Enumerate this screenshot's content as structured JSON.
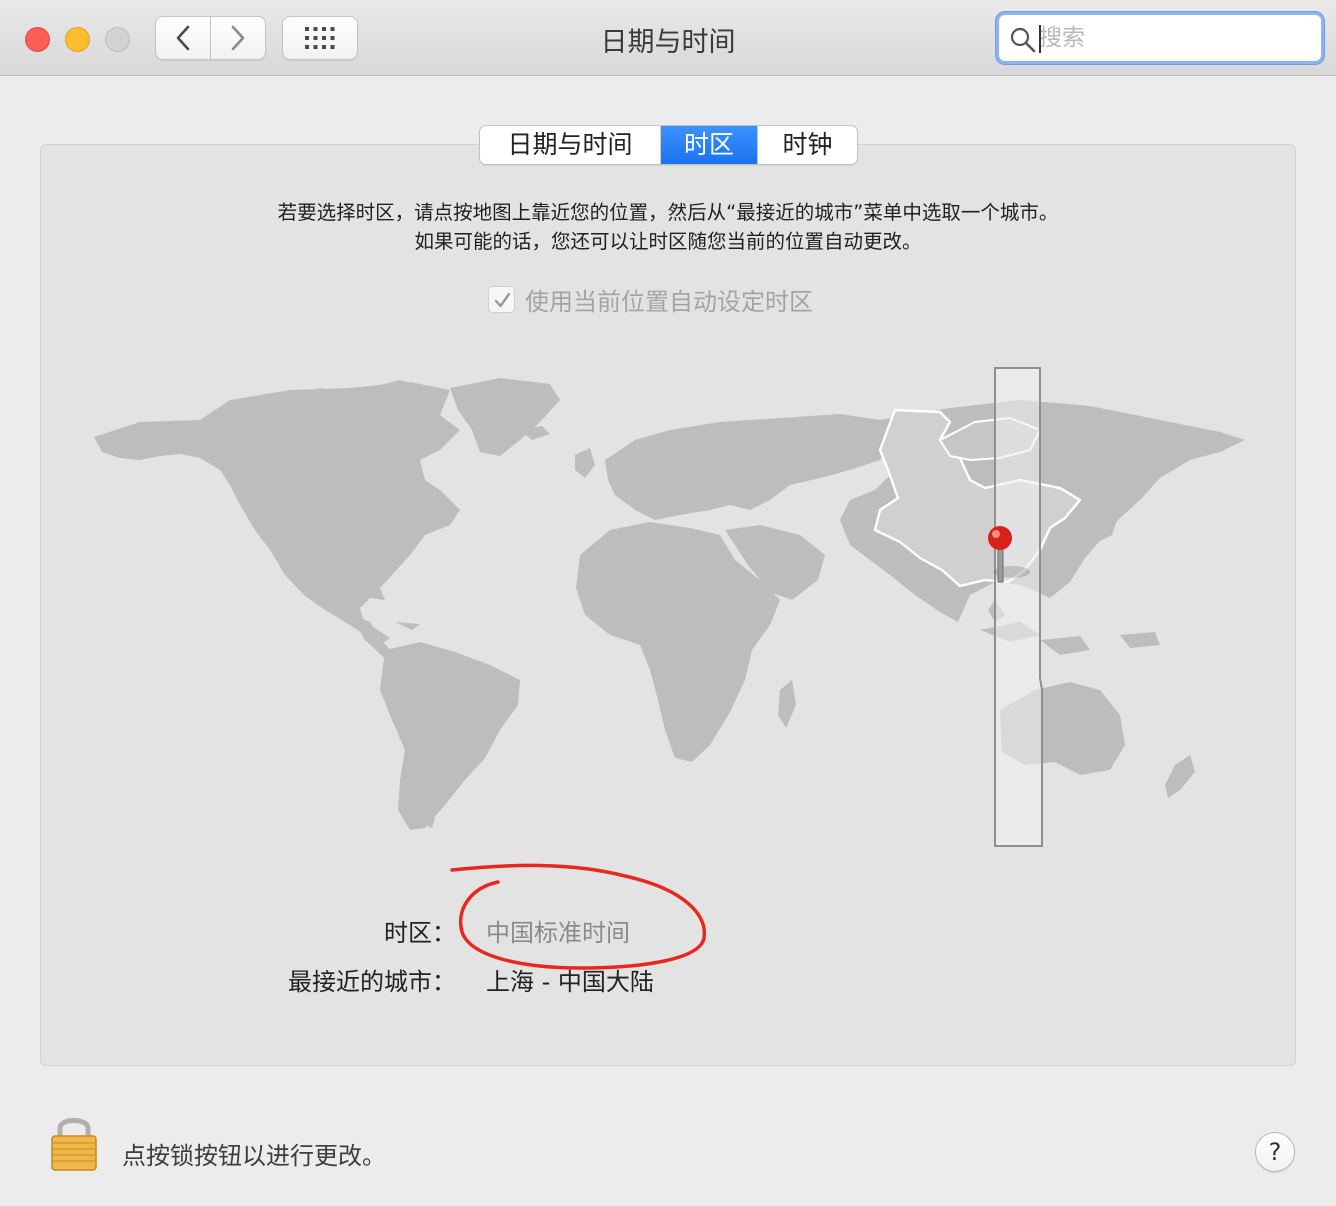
{
  "window": {
    "title": "日期与时间"
  },
  "toolbar": {
    "back_icon": "chevron-left-icon",
    "forward_icon": "chevron-right-icon",
    "grid_icon": "grid-icon"
  },
  "search": {
    "placeholder": "搜索",
    "value": ""
  },
  "tabs": [
    {
      "label": "日期与时间",
      "selected": false
    },
    {
      "label": "时区",
      "selected": true
    },
    {
      "label": "时钟",
      "selected": false
    }
  ],
  "instructions": {
    "line1": "若要选择时区，请点按地图上靠近您的位置，然后从“最接近的城市”菜单中选取一个城市。",
    "line2": "如果可能的话，您还可以让时区随您当前的位置自动更改。"
  },
  "auto_timezone": {
    "label": "使用当前位置自动设定时区",
    "checked": true,
    "enabled": false
  },
  "timezone": {
    "label": "时区：",
    "value": "中国标准时间"
  },
  "closest_city": {
    "label": "最接近的城市：",
    "value": "上海 - 中国大陆"
  },
  "footer": {
    "lock_text": "点按锁按钮以进行更改。",
    "help_label": "?"
  },
  "colors": {
    "accent": "#1a73f0",
    "annotation": "#e8271e",
    "pin": "#d9201a",
    "land": "#bdbdbd",
    "highlight_land": "#d2d2d2"
  }
}
